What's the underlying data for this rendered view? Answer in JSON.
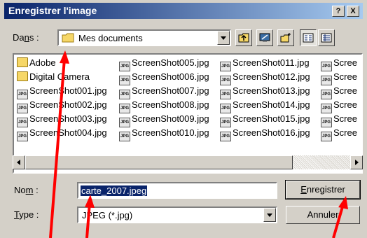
{
  "window": {
    "title": "Enregistrer l'image",
    "help_glyph": "?",
    "close_glyph": "X"
  },
  "location": {
    "label_prefix": "Da",
    "label_underlined": "n",
    "label_suffix": "s :",
    "value": "Mes documents"
  },
  "toolbar": {
    "icons": [
      "folder-up-icon",
      "desktop-icon",
      "new-folder-icon",
      "list-view-icon",
      "details-view-icon"
    ]
  },
  "files": [
    {
      "name": "Adobe",
      "kind": "folder"
    },
    {
      "name": "Digital Camera",
      "kind": "folder"
    },
    {
      "name": "ScreenShot001.jpg",
      "kind": "jpg"
    },
    {
      "name": "ScreenShot002.jpg",
      "kind": "jpg"
    },
    {
      "name": "ScreenShot003.jpg",
      "kind": "jpg"
    },
    {
      "name": "ScreenShot004.jpg",
      "kind": "jpg"
    },
    {
      "name": "ScreenShot005.jpg",
      "kind": "jpg"
    },
    {
      "name": "ScreenShot006.jpg",
      "kind": "jpg"
    },
    {
      "name": "ScreenShot007.jpg",
      "kind": "jpg"
    },
    {
      "name": "ScreenShot008.jpg",
      "kind": "jpg"
    },
    {
      "name": "ScreenShot009.jpg",
      "kind": "jpg"
    },
    {
      "name": "ScreenShot010.jpg",
      "kind": "jpg"
    },
    {
      "name": "ScreenShot011.jpg",
      "kind": "jpg"
    },
    {
      "name": "ScreenShot012.jpg",
      "kind": "jpg"
    },
    {
      "name": "ScreenShot013.jpg",
      "kind": "jpg"
    },
    {
      "name": "ScreenShot014.jpg",
      "kind": "jpg"
    },
    {
      "name": "ScreenShot015.jpg",
      "kind": "jpg"
    },
    {
      "name": "ScreenShot016.jpg",
      "kind": "jpg"
    },
    {
      "name": "Scree",
      "kind": "jpg"
    },
    {
      "name": "Scree",
      "kind": "jpg"
    },
    {
      "name": "Scree",
      "kind": "jpg"
    },
    {
      "name": "Scree",
      "kind": "jpg"
    },
    {
      "name": "Scree",
      "kind": "jpg"
    },
    {
      "name": "Scree",
      "kind": "jpg"
    }
  ],
  "jpg_badge": "JPG",
  "filename": {
    "label_prefix": "No",
    "label_underlined": "m",
    "label_suffix": " :",
    "value": "carte_2007.jpeg"
  },
  "filetype": {
    "label_underlined": "T",
    "label_suffix": "ype :",
    "value": "JPEG (*.jpg)"
  },
  "buttons": {
    "save_underlined": "E",
    "save_rest": "nregistrer",
    "cancel": "Annuler"
  },
  "colors": {
    "title_bar": "#0a246a",
    "selection": "#0a246a",
    "annotation_arrow": "#ff0000"
  }
}
